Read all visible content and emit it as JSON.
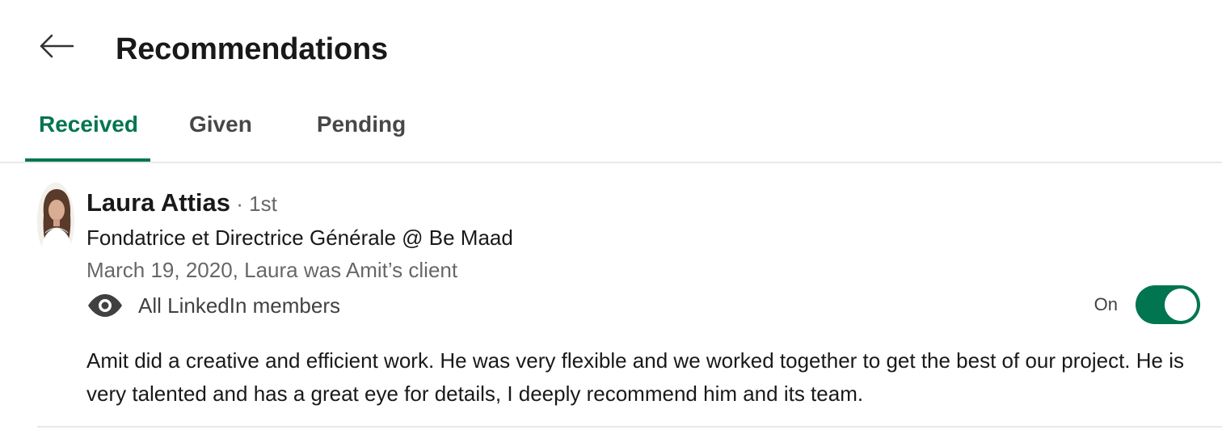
{
  "header": {
    "back_icon": "arrow-left-icon",
    "title": "Recommendations"
  },
  "tabs": [
    {
      "label": "Received",
      "active": true
    },
    {
      "label": "Given",
      "active": false
    },
    {
      "label": "Pending",
      "active": false
    }
  ],
  "recommendation": {
    "author_name": "Laura Attias",
    "degree": " · 1st",
    "headline": "Fondatrice et Directrice Générale @ Be Maad",
    "meta": "March 19, 2020, Laura was Amit’s client",
    "visibility": {
      "icon": "eye-icon",
      "label": "All LinkedIn members"
    },
    "toggle": {
      "state_label": "On",
      "on": true
    },
    "text": "Amit did a creative and efficient work. He was very flexible and we worked together to get the best of our project. He is very talented and has a great eye for details, I deeply recommend him and its team."
  },
  "colors": {
    "accent": "#01754f",
    "divider": "#e8e8e8"
  }
}
